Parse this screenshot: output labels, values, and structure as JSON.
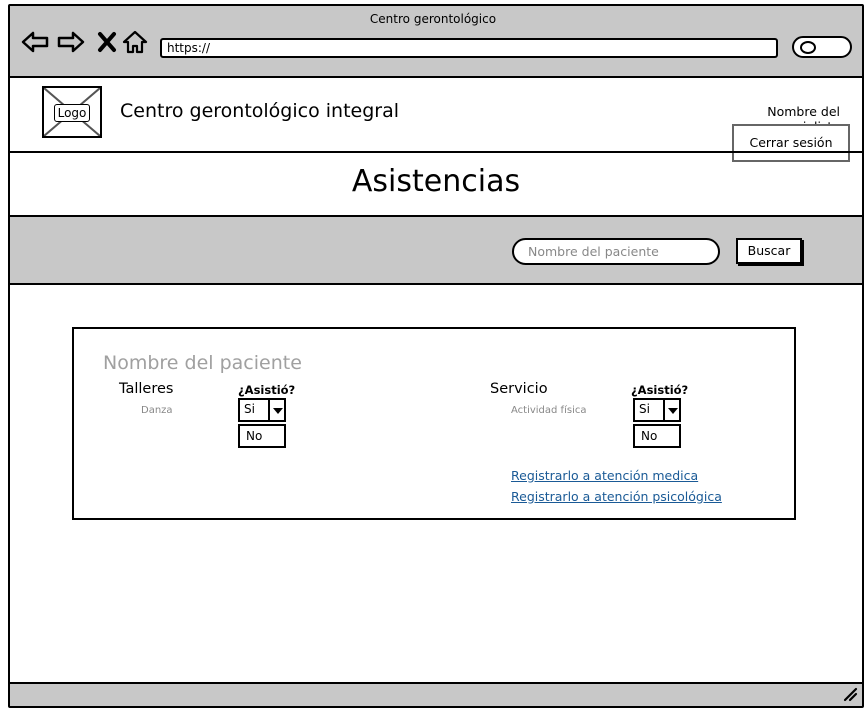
{
  "window": {
    "title": "Centro gerontológico"
  },
  "browser": {
    "url": "https://",
    "icons": [
      "back-arrow-icon",
      "forward-arrow-icon",
      "close-x-icon",
      "home-icon",
      "search-icon"
    ]
  },
  "header": {
    "logo_label": "Logo",
    "site_title": "Centro gerontológico integral",
    "specialist_name": "Nombre del especialista",
    "logout_label": "Cerrar sesión"
  },
  "page": {
    "title": "Asistencias"
  },
  "search": {
    "placeholder": "Nombre del paciente",
    "button_label": "Buscar"
  },
  "panel": {
    "patient_name": "Nombre del paciente",
    "talleres": {
      "heading": "Talleres",
      "question": "¿Asistió?",
      "item": "Danza",
      "selected": "Si",
      "option": "No"
    },
    "servicio": {
      "heading": "Servicio",
      "question": "¿Asistió?",
      "item": "Actividad física",
      "selected": "Si",
      "option": "No"
    },
    "links": {
      "medical": "Registrarlo a atención medica",
      "psych": "Registrarlo a atención psicológica"
    }
  },
  "colors": {
    "chrome_gray": "#c8c8c8",
    "link_blue": "#1a5a96",
    "muted_text": "#a0a0a0"
  }
}
